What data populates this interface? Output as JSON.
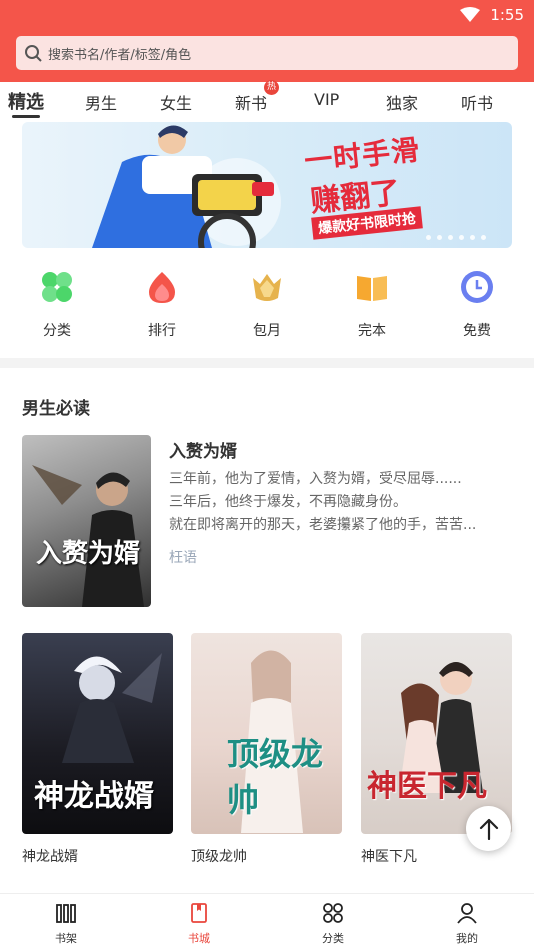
{
  "status_bar": {
    "time": "1:55"
  },
  "search": {
    "placeholder": "搜索书名/作者/标签/角色"
  },
  "tabs": [
    {
      "label": "精选",
      "active": true
    },
    {
      "label": "男生"
    },
    {
      "label": "女生"
    },
    {
      "label": "新书",
      "badge": "热"
    },
    {
      "label": "VIP"
    },
    {
      "label": "独家"
    },
    {
      "label": "听书"
    }
  ],
  "banner": {
    "line1": "一时手滑",
    "line2": "赚翻了",
    "line3": "爆款好书限时抢"
  },
  "quick_entries": [
    {
      "label": "分类",
      "icon": "clover-icon",
      "color": "#4cd66a"
    },
    {
      "label": "排行",
      "icon": "flame-icon",
      "color": "#f4554a"
    },
    {
      "label": "包月",
      "icon": "crown-icon",
      "color": "#e6b34d"
    },
    {
      "label": "完本",
      "icon": "open-book-icon",
      "color": "#f6a830"
    },
    {
      "label": "免费",
      "icon": "clock-icon",
      "color": "#6a7ff0"
    }
  ],
  "section": {
    "title": "男生必读"
  },
  "featured": {
    "cover_text": "入赘为婿",
    "title": "入赘为婿",
    "desc": [
      "三年前，他为了爱情，入赘为婿，受尽屈辱......",
      "三年后，他终于爆发，不再隐藏身份。",
      "就在即将离开的那天，老婆攥紧了他的手，苦苦..."
    ],
    "author": "枉语"
  },
  "grid": [
    {
      "name": "神龙战婿",
      "cover_text": "神龙战婿"
    },
    {
      "name": "顶级龙帅",
      "cover_text": "顶级龙帅"
    },
    {
      "name": "神医下凡",
      "cover_text": "神医下凡"
    }
  ],
  "bottom_nav": [
    {
      "label": "书架",
      "icon": "bookshelf-icon"
    },
    {
      "label": "书城",
      "icon": "bookstore-icon",
      "active": true
    },
    {
      "label": "分类",
      "icon": "grid-icon"
    },
    {
      "label": "我的",
      "icon": "user-icon"
    }
  ],
  "colors": {
    "brand": "#f4554a",
    "active": "#e9463c"
  }
}
